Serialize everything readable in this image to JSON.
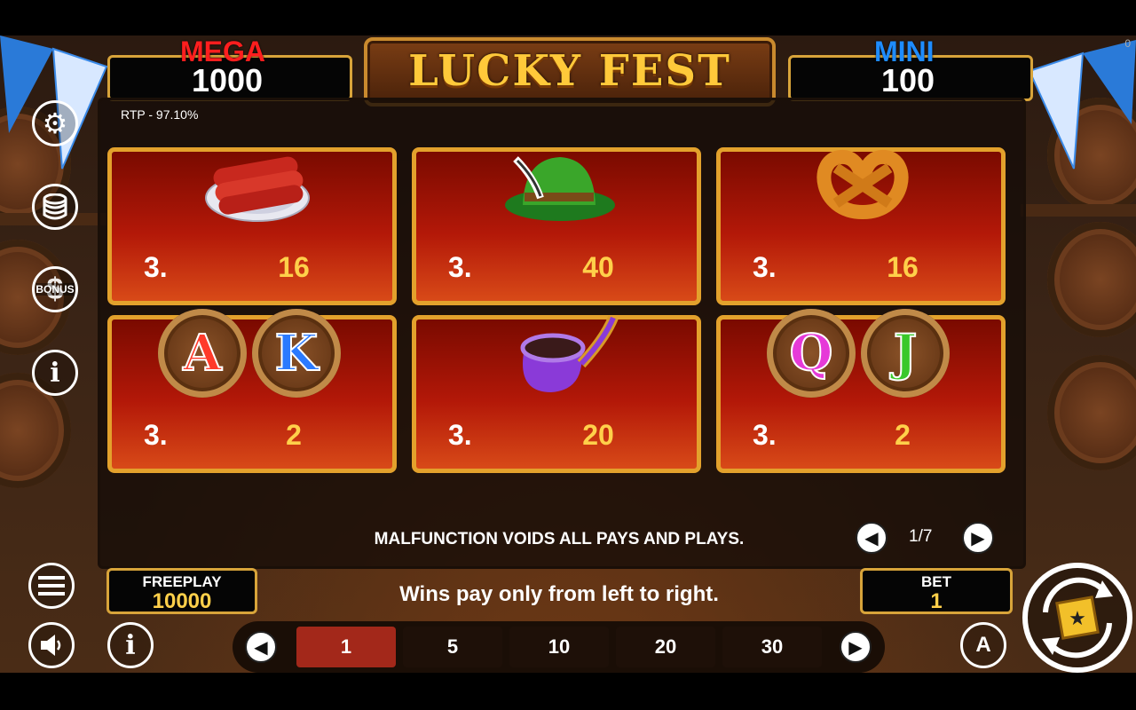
{
  "jackpots": {
    "mega": {
      "label": "MEGA",
      "value": "1000",
      "color": "#ff1e1e"
    },
    "mini": {
      "label": "MINI",
      "value": "100",
      "color": "#1e8cff"
    }
  },
  "logo_text": "LUCKY FEST",
  "rtp": "RTP - 97.10%",
  "corner_text": "0",
  "paytable": [
    {
      "symbol": "sausages",
      "count": "3.",
      "payout": "16"
    },
    {
      "symbol": "green-hat",
      "count": "3.",
      "payout": "40"
    },
    {
      "symbol": "pretzel",
      "count": "3.",
      "payout": "16"
    },
    {
      "symbol": "coin-a-k",
      "count": "3.",
      "payout": "2",
      "letters": [
        "A",
        "K"
      ]
    },
    {
      "symbol": "pipe",
      "count": "3.",
      "payout": "20"
    },
    {
      "symbol": "coin-q-j",
      "count": "3.",
      "payout": "2",
      "letters": [
        "Q",
        "J"
      ]
    }
  ],
  "malfunction_text": "MALFUNCTION VOIDS ALL PAYS AND PLAYS.",
  "pager": {
    "text": "1/7",
    "prev_icon": "chevron-left-icon",
    "next_icon": "chevron-right-icon"
  },
  "side_icons": [
    "gear-icon",
    "coins-stack-icon",
    "bonus-dollar-icon",
    "info-icon"
  ],
  "bonus_label": "BONUS",
  "freeplay": {
    "label": "FREEPLAY",
    "value": "10000"
  },
  "bet": {
    "label": "BET",
    "value": "1"
  },
  "wins_text": "Wins pay only from left to right.",
  "bet_options": [
    "1",
    "5",
    "10",
    "20",
    "30"
  ],
  "bet_selected": "1",
  "bottom_icons": [
    "menu-icon",
    "sound-icon",
    "info-icon",
    "autoplay-icon",
    "spin-icon"
  ],
  "autoplay_label": "A",
  "info_label": "i"
}
